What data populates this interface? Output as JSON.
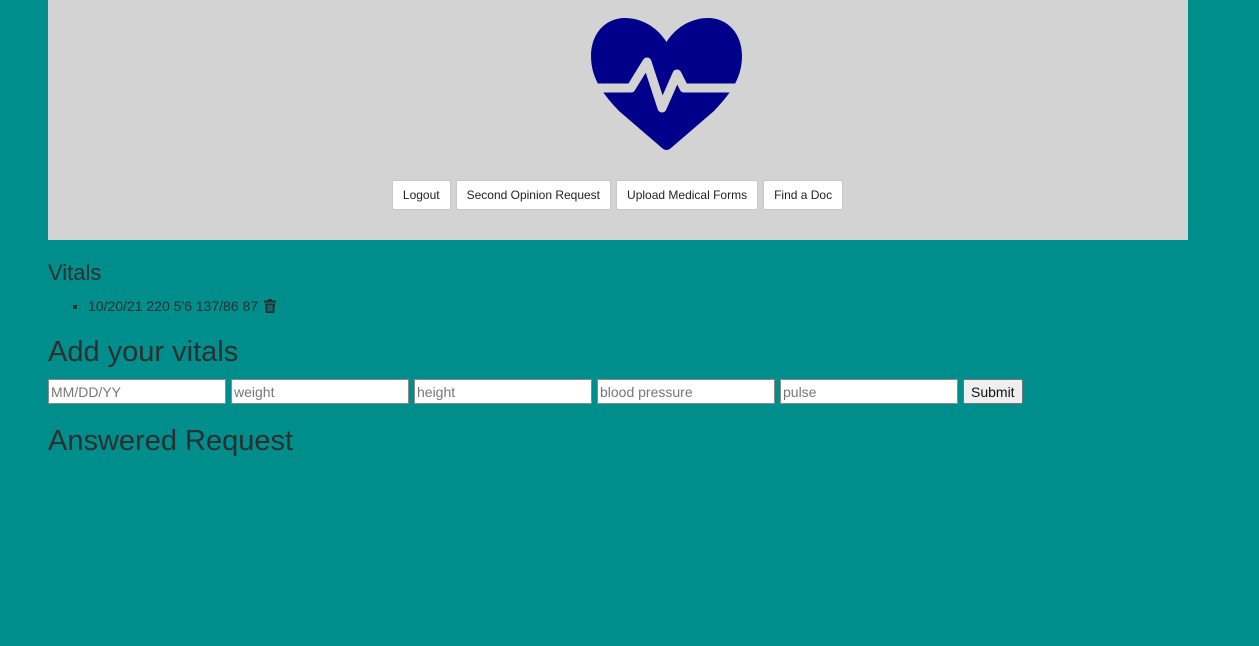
{
  "colors": {
    "page_background": "#008e8c",
    "header_background": "#d3d3d3",
    "heart_color": "#00008b"
  },
  "header": {
    "logo_icon": "heartbeat-icon",
    "nav": {
      "logout": "Logout",
      "second_opinion": "Second Opinion Request",
      "upload_forms": "Upload Medical Forms",
      "find_doc": "Find a Doc"
    }
  },
  "vitals": {
    "heading": "Vitals",
    "entries": [
      {
        "text": "10/20/21 220 5'6 137/86 87",
        "delete_icon": "trash-icon"
      }
    ]
  },
  "add_vitals": {
    "heading": "Add your vitals",
    "date_placeholder": "MM/DD/YY",
    "weight_placeholder": "weight",
    "height_placeholder": "height",
    "bp_placeholder": "blood pressure",
    "pulse_placeholder": "pulse",
    "submit_label": "Submit"
  },
  "answered": {
    "heading": "Answered Request"
  }
}
